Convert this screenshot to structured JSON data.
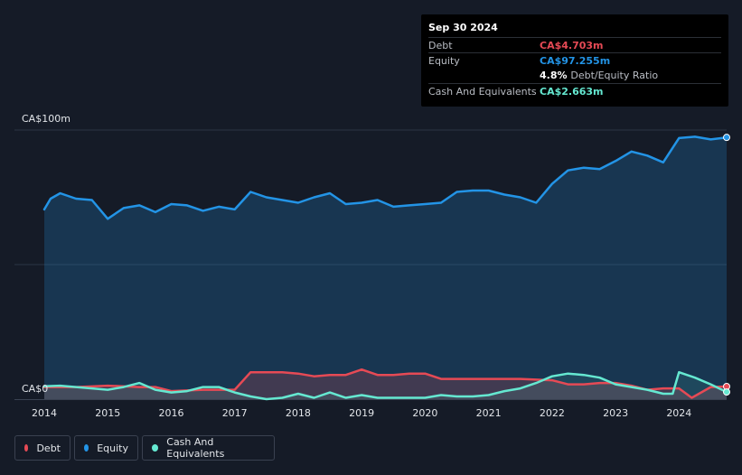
{
  "tooltip": {
    "date": "Sep 30 2024",
    "rows": [
      {
        "label": "Debt",
        "value": "CA$4.703m",
        "color": "#e64a55"
      },
      {
        "label": "Equity",
        "value": "CA$97.255m",
        "color": "#2394e6"
      },
      {
        "label": "",
        "value": "4.8%",
        "extra": "Debt/Equity Ratio",
        "color": "#ffffff"
      },
      {
        "label": "Cash And Equivalents",
        "value": "CA$2.663m",
        "color": "#65e8d1"
      }
    ]
  },
  "legend": [
    {
      "label": "Debt",
      "color": "#e64a55"
    },
    {
      "label": "Equity",
      "color": "#2394e6"
    },
    {
      "label": "Cash And Equivalents",
      "color": "#65e8d1"
    }
  ],
  "chart_data": {
    "type": "area",
    "title": "",
    "xlabel": "",
    "ylabel": "",
    "y_tick_labels": [
      "CA$0",
      "CA$100m"
    ],
    "ylim": [
      0,
      100
    ],
    "xlim": [
      2014.0,
      2024.75
    ],
    "x_ticks": [
      2014,
      2015,
      2016,
      2017,
      2018,
      2019,
      2020,
      2021,
      2022,
      2023,
      2024
    ],
    "grid": "horizontal",
    "legend_position": "bottom-left",
    "series": [
      {
        "name": "Equity",
        "color": "#2394e6",
        "points": [
          [
            2014.0,
            70.5
          ],
          [
            2014.1,
            74.5
          ],
          [
            2014.25,
            76.5
          ],
          [
            2014.5,
            74.5
          ],
          [
            2014.75,
            74.0
          ],
          [
            2015.0,
            67.0
          ],
          [
            2015.25,
            71.0
          ],
          [
            2015.5,
            72.0
          ],
          [
            2015.75,
            69.5
          ],
          [
            2016.0,
            72.5
          ],
          [
            2016.25,
            72.0
          ],
          [
            2016.5,
            70.0
          ],
          [
            2016.75,
            71.5
          ],
          [
            2017.0,
            70.5
          ],
          [
            2017.25,
            77.0
          ],
          [
            2017.5,
            75.0
          ],
          [
            2017.75,
            74.0
          ],
          [
            2018.0,
            73.0
          ],
          [
            2018.25,
            75.0
          ],
          [
            2018.5,
            76.5
          ],
          [
            2018.75,
            72.5
          ],
          [
            2019.0,
            73.0
          ],
          [
            2019.25,
            74.0
          ],
          [
            2019.5,
            71.5
          ],
          [
            2019.75,
            72.0
          ],
          [
            2020.0,
            72.5
          ],
          [
            2020.25,
            73.0
          ],
          [
            2020.5,
            77.0
          ],
          [
            2020.75,
            77.5
          ],
          [
            2021.0,
            77.5
          ],
          [
            2021.25,
            76.0
          ],
          [
            2021.5,
            75.0
          ],
          [
            2021.75,
            73.0
          ],
          [
            2022.0,
            80.0
          ],
          [
            2022.25,
            85.0
          ],
          [
            2022.5,
            86.0
          ],
          [
            2022.75,
            85.5
          ],
          [
            2023.0,
            88.5
          ],
          [
            2023.25,
            92.0
          ],
          [
            2023.5,
            90.5
          ],
          [
            2023.75,
            88.0
          ],
          [
            2024.0,
            97.0
          ],
          [
            2024.25,
            97.5
          ],
          [
            2024.5,
            96.5
          ],
          [
            2024.75,
            97.255
          ]
        ]
      },
      {
        "name": "Debt",
        "color": "#e64a55",
        "points": [
          [
            2014.0,
            4.5
          ],
          [
            2014.5,
            4.5
          ],
          [
            2015.0,
            5.0
          ],
          [
            2015.5,
            4.5
          ],
          [
            2015.75,
            4.5
          ],
          [
            2016.0,
            3.0
          ],
          [
            2016.5,
            3.5
          ],
          [
            2016.75,
            3.5
          ],
          [
            2017.0,
            3.5
          ],
          [
            2017.25,
            10.0
          ],
          [
            2017.5,
            10.0
          ],
          [
            2017.75,
            10.0
          ],
          [
            2018.0,
            9.5
          ],
          [
            2018.25,
            8.5
          ],
          [
            2018.5,
            9.0
          ],
          [
            2018.75,
            9.0
          ],
          [
            2019.0,
            11.0
          ],
          [
            2019.25,
            9.0
          ],
          [
            2019.5,
            9.0
          ],
          [
            2019.75,
            9.5
          ],
          [
            2020.0,
            9.5
          ],
          [
            2020.25,
            7.5
          ],
          [
            2020.5,
            7.5
          ],
          [
            2021.0,
            7.5
          ],
          [
            2021.5,
            7.5
          ],
          [
            2022.0,
            7.0
          ],
          [
            2022.25,
            5.5
          ],
          [
            2022.5,
            5.5
          ],
          [
            2022.75,
            6.0
          ],
          [
            2023.0,
            6.0
          ],
          [
            2023.25,
            5.0
          ],
          [
            2023.5,
            3.5
          ],
          [
            2023.75,
            4.0
          ],
          [
            2024.0,
            4.0
          ],
          [
            2024.2,
            0.5
          ],
          [
            2024.5,
            4.5
          ],
          [
            2024.75,
            4.703
          ]
        ]
      },
      {
        "name": "Cash And Equivalents",
        "color": "#65e8d1",
        "points": [
          [
            2014.0,
            4.8
          ],
          [
            2014.25,
            5.0
          ],
          [
            2014.5,
            4.5
          ],
          [
            2014.75,
            4.0
          ],
          [
            2015.0,
            3.5
          ],
          [
            2015.25,
            4.5
          ],
          [
            2015.5,
            6.0
          ],
          [
            2015.75,
            3.5
          ],
          [
            2016.0,
            2.5
          ],
          [
            2016.25,
            3.0
          ],
          [
            2016.5,
            4.5
          ],
          [
            2016.75,
            4.5
          ],
          [
            2017.0,
            2.5
          ],
          [
            2017.25,
            1.0
          ],
          [
            2017.5,
            0.0
          ],
          [
            2017.75,
            0.5
          ],
          [
            2018.0,
            2.0
          ],
          [
            2018.25,
            0.5
          ],
          [
            2018.5,
            2.5
          ],
          [
            2018.75,
            0.5
          ],
          [
            2019.0,
            1.5
          ],
          [
            2019.25,
            0.5
          ],
          [
            2019.5,
            0.5
          ],
          [
            2019.75,
            0.5
          ],
          [
            2020.0,
            0.5
          ],
          [
            2020.25,
            1.5
          ],
          [
            2020.5,
            1.0
          ],
          [
            2020.75,
            1.0
          ],
          [
            2021.0,
            1.5
          ],
          [
            2021.25,
            3.0
          ],
          [
            2021.5,
            4.0
          ],
          [
            2021.75,
            6.0
          ],
          [
            2022.0,
            8.5
          ],
          [
            2022.25,
            9.5
          ],
          [
            2022.5,
            9.0
          ],
          [
            2022.75,
            8.0
          ],
          [
            2023.0,
            5.5
          ],
          [
            2023.25,
            4.5
          ],
          [
            2023.5,
            3.5
          ],
          [
            2023.75,
            2.0
          ],
          [
            2023.9,
            2.0
          ],
          [
            2024.0,
            10.0
          ],
          [
            2024.25,
            8.0
          ],
          [
            2024.5,
            5.5
          ],
          [
            2024.75,
            2.663
          ]
        ]
      }
    ]
  }
}
